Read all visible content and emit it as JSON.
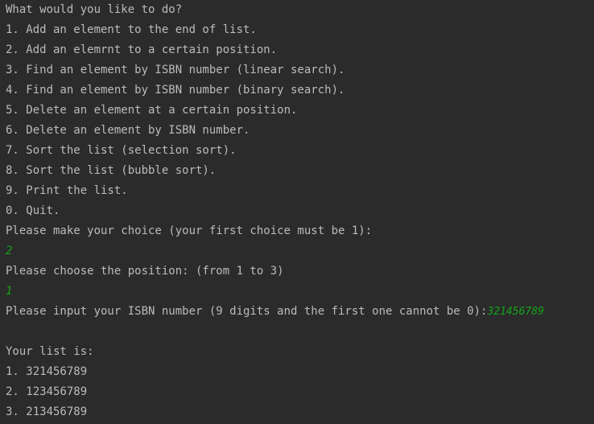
{
  "console": {
    "prompt_title": "What would you like to do?",
    "menu": [
      "1. Add an element to the end of list.",
      "2. Add an elemrnt to a certain position.",
      "3. Find an element by ISBN number (linear search).",
      "4. Find an element by ISBN number (binary search).",
      "5. Delete an element at a certain position.",
      "6. Delete an element by ISBN number.",
      "7. Sort the list (selection sort).",
      "8. Sort the list (bubble sort).",
      "9. Print the list.",
      "0. Quit."
    ],
    "choice_prompt": "Please make your choice (your first choice must be 1):",
    "choice_input": "2",
    "position_prompt": "Please choose the position: (from 1 to 3)",
    "position_input": "1",
    "isbn_prompt": "Please input your ISBN number (9 digits and the first one cannot be 0):",
    "isbn_input": "321456789",
    "list_header": "Your list is:",
    "list_items": [
      "1. 321456789",
      "2. 123456789",
      "3. 213456789"
    ]
  },
  "colors": {
    "background": "#2b2b2b",
    "text": "#bbbbbb",
    "user_input": "#15a31a"
  }
}
